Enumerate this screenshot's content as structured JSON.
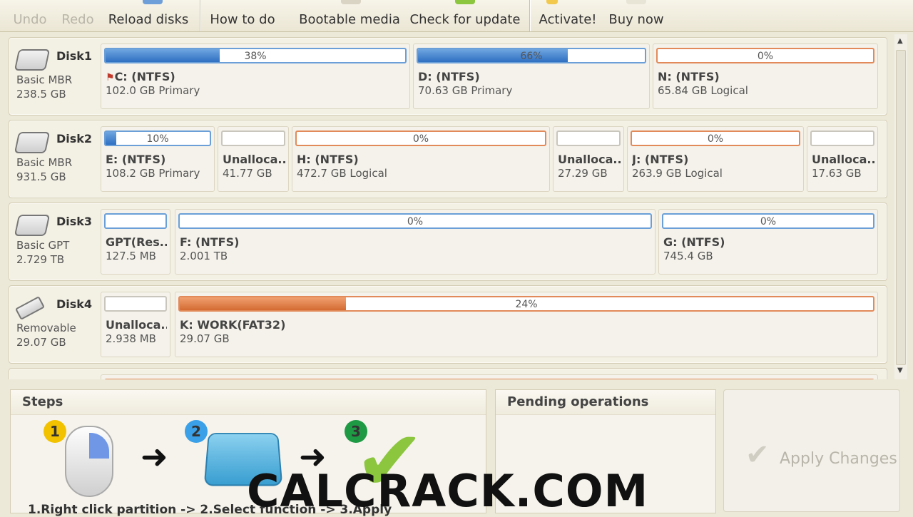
{
  "toolbar": {
    "undo": "Undo",
    "redo": "Redo",
    "reload": "Reload disks",
    "how_to": "How to do",
    "bootable": "Bootable media",
    "check_update": "Check for update",
    "activate": "Activate!",
    "buy": "Buy now"
  },
  "disks": [
    {
      "name": "Disk1",
      "type": "Basic MBR",
      "size": "238.5 GB",
      "partitions": [
        {
          "pct": "38%",
          "used": 0.38,
          "name": "C: (NTFS)",
          "desc": "102.0 GB Primary",
          "kind": "primary",
          "flag": true
        },
        {
          "pct": "66%",
          "used": 0.66,
          "name": "D: (NTFS)",
          "desc": "70.63 GB Primary",
          "kind": "primary"
        },
        {
          "pct": "0%",
          "used": 0,
          "name": "N: (NTFS)",
          "desc": "65.84 GB Logical",
          "kind": "logical"
        }
      ]
    },
    {
      "name": "Disk2",
      "type": "Basic MBR",
      "size": "931.5 GB",
      "partitions": [
        {
          "pct": "10%",
          "used": 0.1,
          "name": "E: (NTFS)",
          "desc": "108.2 GB Primary",
          "kind": "primary"
        },
        {
          "pct": "",
          "used": 0,
          "name": "Unalloca...",
          "desc": "41.77 GB",
          "kind": "unalloc"
        },
        {
          "pct": "0%",
          "used": 0,
          "name": "H: (NTFS)",
          "desc": "472.7 GB Logical",
          "kind": "logical"
        },
        {
          "pct": "",
          "used": 0,
          "name": "Unalloca...",
          "desc": "27.29 GB",
          "kind": "unalloc"
        },
        {
          "pct": "0%",
          "used": 0,
          "name": "J: (NTFS)",
          "desc": "263.9 GB Logical",
          "kind": "logical"
        },
        {
          "pct": "",
          "used": 0,
          "name": "Unalloca...",
          "desc": "17.63 GB",
          "kind": "unalloc"
        }
      ]
    },
    {
      "name": "Disk3",
      "type": "Basic GPT",
      "size": "2.729 TB",
      "partitions": [
        {
          "pct": "",
          "used": 0,
          "name": "GPT(Res...",
          "desc": "127.5 MB",
          "kind": "primary"
        },
        {
          "pct": "0%",
          "used": 0,
          "name": "F: (NTFS)",
          "desc": "2.001 TB",
          "kind": "primary"
        },
        {
          "pct": "0%",
          "used": 0,
          "name": "G: (NTFS)",
          "desc": "745.4 GB",
          "kind": "primary"
        }
      ]
    },
    {
      "name": "Disk4",
      "type": "Removable",
      "size": "29.07 GB",
      "partitions": [
        {
          "pct": "",
          "used": 0,
          "name": "Unalloca...",
          "desc": "2.938 MB",
          "kind": "unalloc"
        },
        {
          "pct": "24%",
          "used": 0.24,
          "name": "K: WORK(FAT32)",
          "desc": "29.07 GB",
          "kind": "logical"
        }
      ]
    }
  ],
  "steps": {
    "title": "Steps",
    "numbers": [
      "1",
      "2",
      "3"
    ],
    "text": "1.Right click partition -> 2.Select function -> 3.Apply"
  },
  "pending": {
    "title": "Pending operations"
  },
  "apply": {
    "label": "Apply Changes"
  },
  "watermark": "CALCRACK.COM",
  "colors": {
    "primary_bar": "#2e6fc2",
    "logical_bar": "#d46a32",
    "apply_disabled": "#b9b5aa",
    "step1": "#f2c200",
    "step2": "#3aa0e8",
    "step3": "#1e9a45"
  }
}
